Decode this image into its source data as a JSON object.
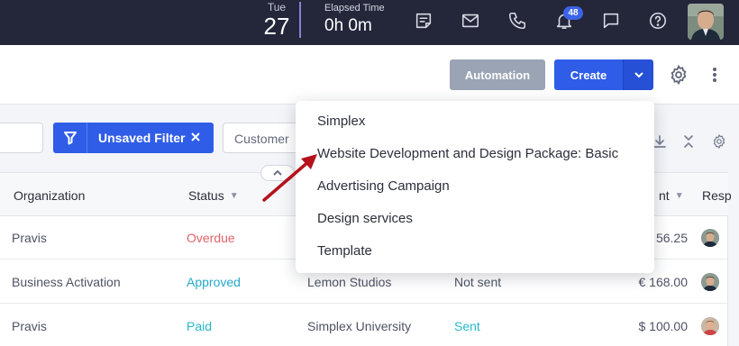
{
  "topbar": {
    "date_dow": "Tue",
    "date_day": "27",
    "elapsed_label": "Elapsed Time",
    "elapsed_value": "0h 0m",
    "notification_count": "48",
    "accent_color": "#3b63e6"
  },
  "actionbar": {
    "automation_label": "Automation",
    "create_label": "Create"
  },
  "filters": {
    "unsaved_filter_label": "Unsaved Filter",
    "customer_placeholder": "Customer"
  },
  "create_menu": {
    "items": [
      "Simplex",
      "Website Development and Design Package: Basic",
      "Advertising Campaign",
      "Design services",
      "Template"
    ]
  },
  "table": {
    "headers": {
      "organization": "Organization",
      "status": "Status",
      "amount": "nt",
      "responsible": "Resp"
    },
    "rows": [
      {
        "organization": "Pravis",
        "status": "Overdue",
        "customer": "",
        "sent": "",
        "amount": "56.25"
      },
      {
        "organization": "Business Activation",
        "status": "Approved",
        "customer": "Lemon Studios",
        "sent": "Not sent",
        "amount": "€ 168.00"
      },
      {
        "organization": "Pravis",
        "status": "Paid",
        "customer": "Simplex University",
        "sent": "Sent",
        "amount": "$ 100.00"
      }
    ]
  }
}
